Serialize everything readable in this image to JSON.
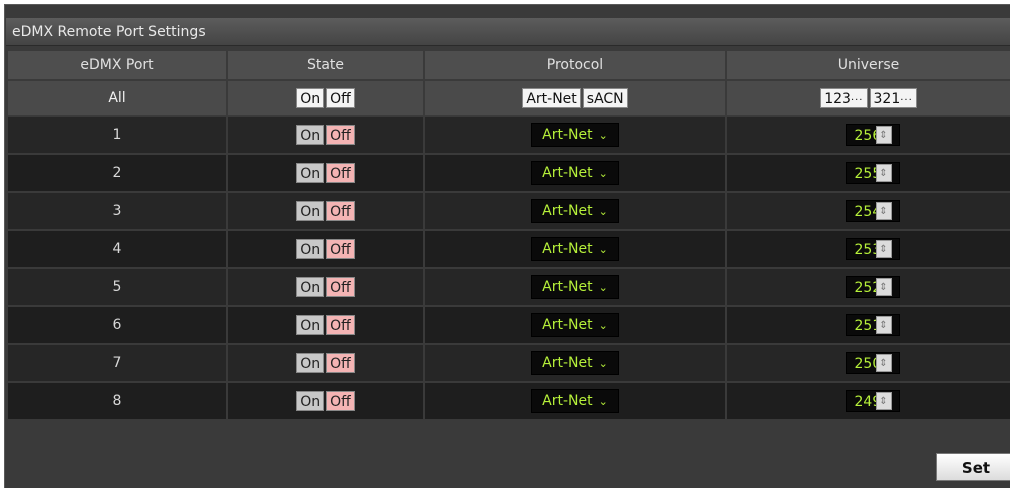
{
  "panel": {
    "title": "eDMX Remote Port Settings"
  },
  "columns": [
    "eDMX Port",
    "State",
    "Protocol",
    "Universe"
  ],
  "all_row": {
    "port": "All",
    "state_on": "On",
    "state_off": "Off",
    "proto_artnet": "Art-Net",
    "proto_sacn": "sACN",
    "universe_asc": "123",
    "universe_desc": "321",
    "dots": "···"
  },
  "ports": [
    {
      "port": "1",
      "on": "On",
      "off": "Off",
      "protocol": "Art-Net",
      "universe": "256"
    },
    {
      "port": "2",
      "on": "On",
      "off": "Off",
      "protocol": "Art-Net",
      "universe": "255"
    },
    {
      "port": "3",
      "on": "On",
      "off": "Off",
      "protocol": "Art-Net",
      "universe": "254"
    },
    {
      "port": "4",
      "on": "On",
      "off": "Off",
      "protocol": "Art-Net",
      "universe": "253"
    },
    {
      "port": "5",
      "on": "On",
      "off": "Off",
      "protocol": "Art-Net",
      "universe": "252"
    },
    {
      "port": "6",
      "on": "On",
      "off": "Off",
      "protocol": "Art-Net",
      "universe": "251"
    },
    {
      "port": "7",
      "on": "On",
      "off": "Off",
      "protocol": "Art-Net",
      "universe": "250"
    },
    {
      "port": "8",
      "on": "On",
      "off": "Off",
      "protocol": "Art-Net",
      "universe": "249"
    }
  ],
  "icons": {
    "dropdown": "chevron-down-icon",
    "spinner": "spinner-icon"
  },
  "colors": {
    "value_text": "#b6f03a",
    "off_active": "#f4b4b4",
    "panel_bg": "#3a3a3a"
  },
  "footer": {
    "set_label": "Set"
  }
}
